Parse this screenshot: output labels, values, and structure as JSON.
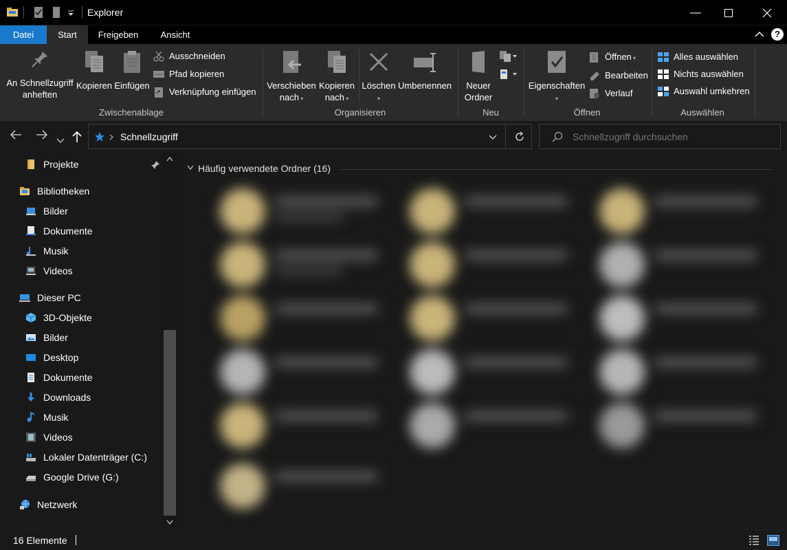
{
  "window": {
    "title": "Explorer",
    "minimize_glyph": "—",
    "maximize_glyph": "☐",
    "close_glyph": "✕"
  },
  "ribbon_tabs": [
    {
      "label": "Datei"
    },
    {
      "label": "Start"
    },
    {
      "label": "Freigeben"
    },
    {
      "label": "Ansicht"
    }
  ],
  "ribbon": {
    "clipboard": {
      "label": "Zwischenablage",
      "pin_line1": "An Schnellzugriff",
      "pin_line2": "anheften",
      "copy": "Kopieren",
      "paste": "Einfügen",
      "cut": "Ausschneiden",
      "copy_path": "Pfad kopieren",
      "paste_shortcut": "Verknüpfung einfügen"
    },
    "organize": {
      "label": "Organisieren",
      "move_line1": "Verschieben",
      "move_line2": "nach",
      "copyto_line1": "Kopieren",
      "copyto_line2": "nach",
      "delete": "Löschen",
      "rename": "Umbenennen"
    },
    "new": {
      "label": "Neu",
      "folder_line1": "Neuer",
      "folder_line2": "Ordner"
    },
    "open": {
      "label": "Öffnen",
      "properties": "Eigenschaften",
      "open": "Öffnen",
      "edit": "Bearbeiten",
      "history": "Verlauf"
    },
    "select": {
      "label": "Auswählen",
      "select_all": "Alles auswählen",
      "select_none": "Nichts auswählen",
      "invert": "Auswahl umkehren"
    }
  },
  "address": {
    "location": "Schnellzugriff",
    "search_placeholder": "Schnellzugriff durchsuchen"
  },
  "nav": {
    "pinned": [
      {
        "label": "Projekte"
      }
    ],
    "libraries": {
      "label": "Bibliotheken",
      "items": [
        {
          "label": "Bilder"
        },
        {
          "label": "Dokumente"
        },
        {
          "label": "Musik"
        },
        {
          "label": "Videos"
        }
      ]
    },
    "this_pc": {
      "label": "Dieser PC",
      "items": [
        {
          "label": "3D-Objekte"
        },
        {
          "label": "Bilder"
        },
        {
          "label": "Desktop"
        },
        {
          "label": "Dokumente"
        },
        {
          "label": "Downloads"
        },
        {
          "label": "Musik"
        },
        {
          "label": "Videos"
        },
        {
          "label": "Lokaler Datenträger (C:)"
        },
        {
          "label": "Google Drive (G:)"
        }
      ]
    },
    "network": {
      "label": "Netzwerk"
    }
  },
  "content": {
    "group_header": "Häufig verwendete Ordner (16)"
  },
  "status": {
    "count": "16 Elemente"
  },
  "colors": {
    "accent": "#1979ca",
    "folder": "#e8c46b",
    "bg": "#191919",
    "ribbon": "#2b2b2b"
  }
}
